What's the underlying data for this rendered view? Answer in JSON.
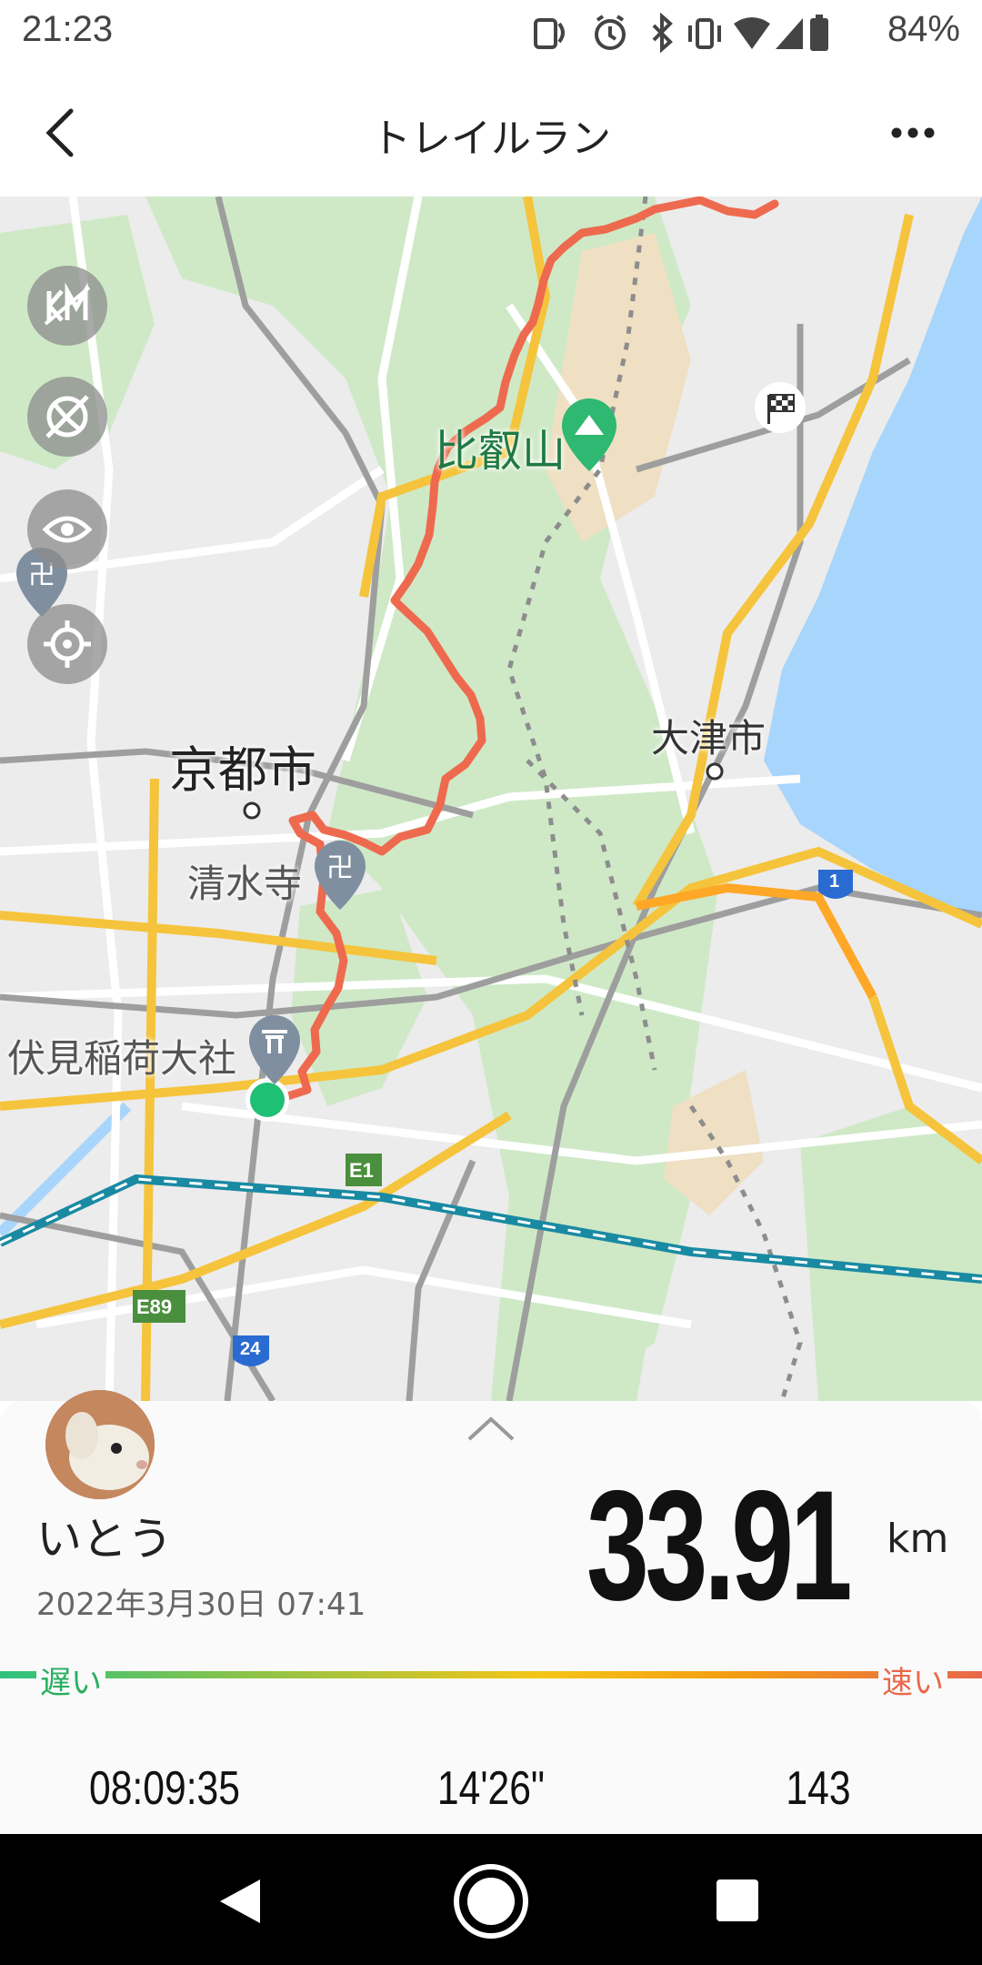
{
  "status_bar": {
    "time": "21:23",
    "battery": "84%",
    "icons": [
      "nfc-icon",
      "alarm-icon",
      "bluetooth-icon",
      "vibrate-icon",
      "wifi-icon",
      "signal-icon",
      "battery-icon"
    ]
  },
  "header": {
    "title": "トレイルラン",
    "back_icon": "back-arrow-icon",
    "menu_icon": "more-dots-icon"
  },
  "map": {
    "labels": {
      "mount_hiei": "比叡山",
      "kyoto_city": "京都市",
      "otsu_city": "大津市",
      "kiyomizu": "清水寺",
      "fushimi": "伏見稲荷大社",
      "road_e1": "E1",
      "road_e89": "E89",
      "route_24": "24",
      "route_1": "1"
    },
    "controls": [
      "km-markers-icon",
      "hide-route-icon",
      "eye-icon",
      "locate-icon"
    ],
    "colors": {
      "route": "#ee6a4f",
      "start": "#1fbf74",
      "water": "#a8d5fb",
      "forest": "#cfe9c7",
      "rail": "#1a8aa3"
    }
  },
  "summary": {
    "expand_icon": "chevron-up-icon",
    "username": "いとう",
    "datetime": "2022年3月30日 07:41",
    "distance": "33.91",
    "distance_unit": "km",
    "pace_slow_label": "遅い",
    "pace_fast_label": "速い",
    "duration": "08:09:35",
    "pace": "14'26\"",
    "third_stat": "143"
  },
  "nav_bar": {
    "icons": [
      "back-triangle-icon",
      "home-circle-icon",
      "recents-square-icon"
    ]
  }
}
